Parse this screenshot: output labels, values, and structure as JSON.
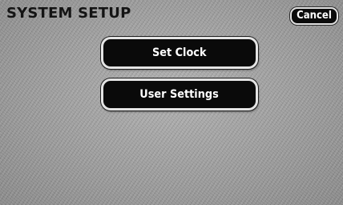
{
  "header": {
    "title": "SYSTEM SETUP",
    "cancel_label": "Cancel"
  },
  "menu": {
    "items": [
      {
        "label": "Set Clock"
      },
      {
        "label": "User Settings"
      }
    ]
  }
}
